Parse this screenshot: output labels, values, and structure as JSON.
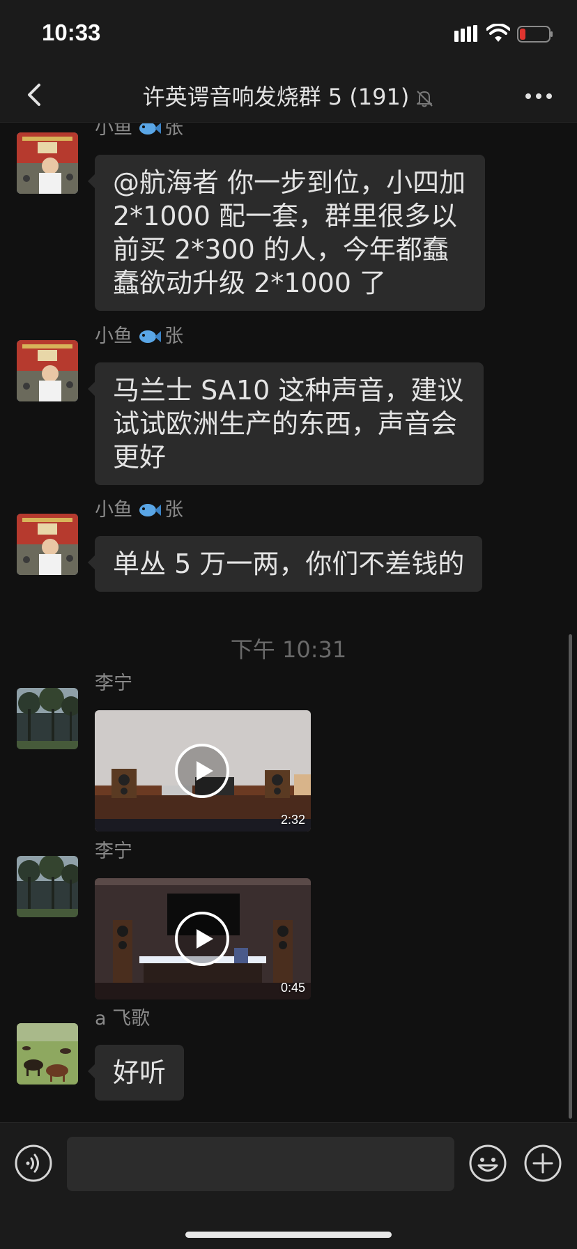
{
  "status_bar": {
    "time": "10:33",
    "battery_color": "#e0342f"
  },
  "header": {
    "title": "许英谔音响发烧群 5 (191)"
  },
  "messages": [
    {
      "sender": "小鱼",
      "sender_suffix": "张",
      "avatar": "avatar-tiananmen",
      "text": "@航海者 你一步到位，小四加 2*1000 配一套，群里很多以前买 2*300 的人，今年都蠢蠢欲动升级 2*1000 了"
    },
    {
      "sender": "小鱼",
      "sender_suffix": "张",
      "avatar": "avatar-tiananmen",
      "text": "马兰士 SA10 这种声音，建议试试欧洲生产的东西，声音会更好"
    },
    {
      "sender": "小鱼",
      "sender_suffix": "张",
      "avatar": "avatar-tiananmen",
      "text": "单丛 5 万一两，你们不差钱的"
    },
    {
      "time_divider": "下午 10:31"
    },
    {
      "sender": "李宁",
      "avatar": "avatar-trees",
      "video_duration": "2:32"
    },
    {
      "sender": "李宁",
      "avatar": "avatar-trees",
      "video_duration": "0:45"
    },
    {
      "sender": "a 飞歌",
      "avatar": "avatar-horses",
      "text": "好听"
    }
  ],
  "input": {
    "placeholder": "",
    "value": ""
  },
  "colors": {
    "background": "#111111",
    "bar": "#1b1b1b",
    "bubble": "#2b2b2b",
    "text": "#e4e4e4",
    "muted": "#8a8a8a"
  }
}
